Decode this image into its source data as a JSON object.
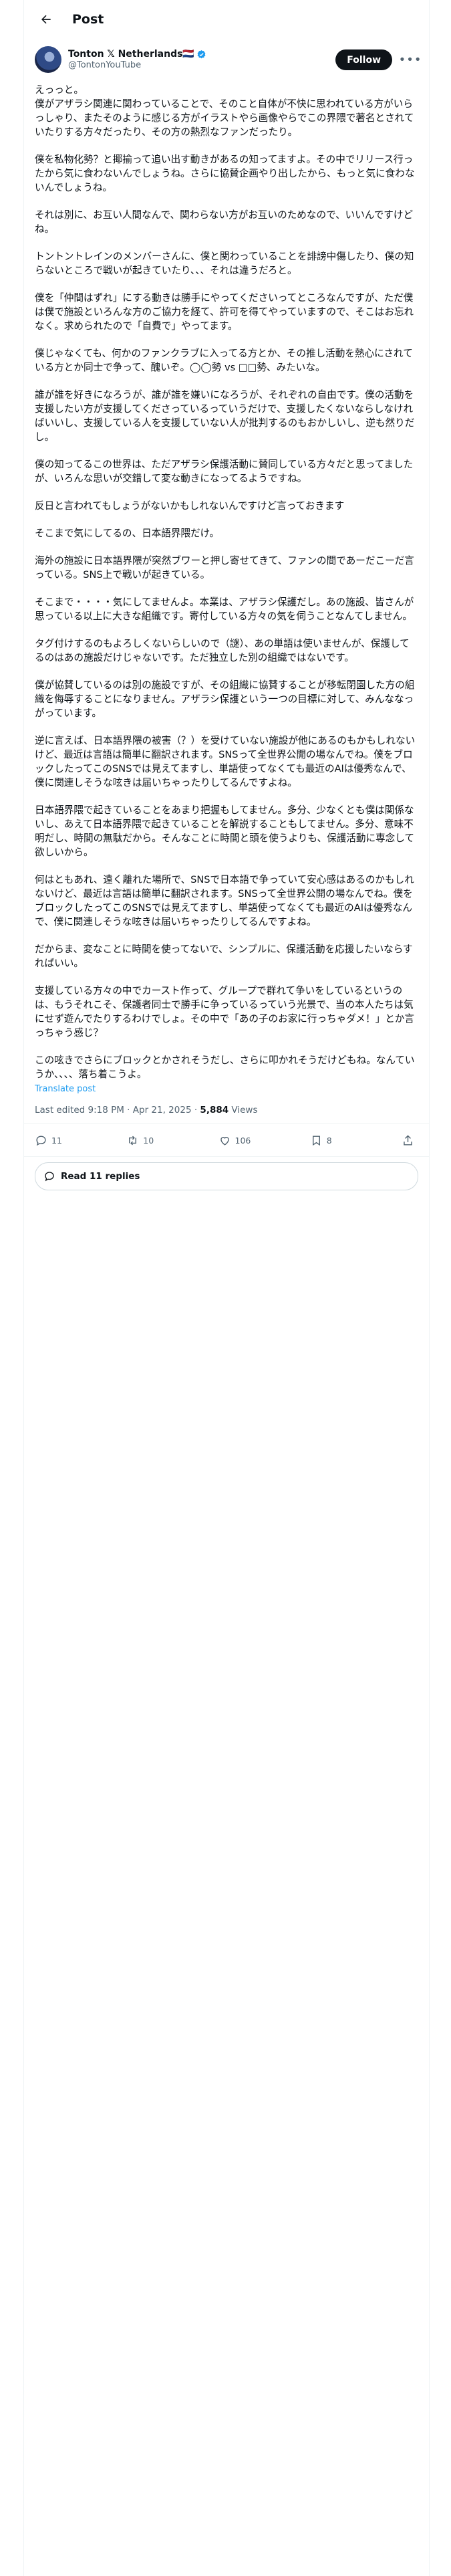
{
  "header": {
    "title": "Post"
  },
  "author": {
    "name": "Tonton 𝕏 Netherlands🇳🇱",
    "handle": "@TontonYouTube",
    "follow_label": "Follow"
  },
  "post": {
    "paragraphs": [
      "えっっと。\n僕がアザラシ関連に関わっていることで、そのこと自体が不快に思われている方がいらっしゃり、またそのように感じる方がイラストやら画像やらでこの界隈で著名とされていたりする方々だったり、その方の熱烈なファンだったり。",
      "僕を私物化勢？と揶揄って追い出す動きがあるの知ってますよ。その中でリリース行ったから気に食わないんでしょうね。さらに協賛企画やり出したから、もっと気に食わないんでしょうね。",
      "それは別に、お互い人間なんで、関わらない方がお互いのためなので、いいんですけどね。",
      "トントントレインのメンバーさんに、僕と関わっていることを誹謗中傷したり、僕の知らないところで戦いが起きていたり、、、それは違うだろと。",
      "僕を「仲間はずれ」にする動きは勝手にやってくださいってところなんですが、ただ僕は僕で施設といろんな方のご協力を経て、許可を得てやっていますので、そこはお忘れなく。求められたので「自費で」やってます。",
      "僕じゃなくても、何かのファンクラブに入ってる方とか、その推し活動を熱心にされている方とか同士で争って、醜いぞ。◯◯勢 vs □□勢、みたいな。",
      "誰が誰を好きになろうが、誰が誰を嫌いになろうが、それぞれの自由です。僕の活動を支援したい方が支援してくださっているっていうだけで、支援したくないならしなければいいし、支援している人を支援していない人が批判するのもおかしいし、逆も然りだし。",
      "僕の知ってるこの世界は、ただアザラシ保護活動に賛同している方々だと思ってましたが、いろんな思いが交錯して変な動きになってるようですね。",
      "反日と言われてもしょうがないかもしれないんですけど言っておきます",
      "そこまで気にしてるの、日本語界隈だけ。",
      "海外の施設に日本語界隈が突然ブワーと押し寄せてきて、ファンの間であーだこーだ言っている。SNS上で戦いが起きている。",
      "そこまで・・・・気にしてませんよ。本業は、アザラシ保護だし。あの施設、皆さんが思っている以上に大きな組織です。寄付している方々の気を伺うことなんてしません。",
      "タグ付けするのもよろしくないらしいので（謎）、あの単語は使いませんが、保護してるのはあの施設だけじゃないです。ただ独立した別の組織ではないです。",
      "僕が協賛しているのは別の施設ですが、その組織に協賛することが移転閉園した方の組織を侮辱することになりません。アザラシ保護という一つの目標に対して、みんななっがっています。",
      "逆に言えば、日本語界隈の被害（？）を受けていない施設が他にあるのもかもしれないけど、最近は言語は簡単に翻訳されます。SNSって全世界公開の場なんでね。僕をブロックしたってこのSNSでは見えてますし、単語使ってなくても最近のAIは優秀なんで、僕に関連しそうな呟きは届いちゃったりしてるんですよね。",
      "日本語界隈で起きていることをあまり把握もしてません。多分、少なくとも僕は関係ないし、あえて日本語界隈で起きていることを解説することもしてません。多分、意味不明だし、時間の無駄だから。そんなことに時間と頭を使うよりも、保護活動に専念して欲しいから。",
      "何はともあれ、遠く離れた場所で、SNSで日本語で争っていて安心感はあるのかもしれないけど、最近は言語は簡単に翻訳されます。SNSって全世界公開の場なんでね。僕をブロックしたってこのSNSでは見えてますし、単語使ってなくても最近のAIは優秀なんで、僕に関連しそうな呟きは届いちゃったりしてるんですよね。",
      "だからま、変なことに時間を使ってないで、シンプルに、保護活動を応援したいならすればいい。",
      "支援している方々の中でカースト作って、グループで群れて争いをしているというのは、もうそれこそ、保護者同士で勝手に争っているっていう光景で、当の本人たちは気にせず遊んでたりするわけでしょ。その中で「あの子のお家に行っちゃダメ！」とか言っちゃう感じ？",
      "この呟きでさらにブロックとかされそうだし、さらに叩かれそうだけどもね。なんていうか、、、、落ち着こうよ。"
    ],
    "translate_label": "Translate post",
    "timestamp": "Last edited 9:18 PM · Apr 21, 2025",
    "views_count": "5,884",
    "views_label": "Views"
  },
  "actions": {
    "reply_count": "11",
    "repost_count": "10",
    "like_count": "106",
    "bookmark_count": "8"
  },
  "replies": {
    "label": "Read 11 replies"
  }
}
